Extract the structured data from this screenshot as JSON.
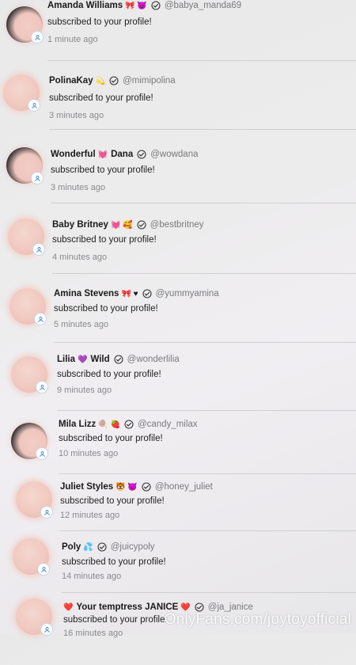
{
  "notifications": [
    {
      "name": "Amanda Williams",
      "emoji": "🎀 😈",
      "handle": "@babya_manda69",
      "message": "subscribed to your profile!",
      "time": "1 minute ago"
    },
    {
      "name": "PolinaKay",
      "emoji": "💫",
      "handle": "@mimipolina",
      "message": "subscribed to your profile!",
      "time": "3 minutes ago"
    },
    {
      "name": "Wonderful",
      "emoji": "💓",
      "name2": "Dana",
      "handle": "@wowdana",
      "message": "subscribed to your profile!",
      "time": "3 minutes ago"
    },
    {
      "name": "Baby Britney",
      "emoji": "💓 🥰",
      "handle": "@bestbritney",
      "message": "subscribed to your profile!",
      "time": "4 minutes ago"
    },
    {
      "name": "Amina Stevens",
      "emoji": "🎀 ♥",
      "handle": "@yummyamina",
      "message": "subscribed to your profile!",
      "time": "5 minutes ago"
    },
    {
      "name": "Lilia",
      "emoji": "💜",
      "name2": "Wild",
      "handle": "@wonderlilia",
      "message": "subscribed to your profile!",
      "time": "9 minutes ago"
    },
    {
      "name": "Mila Lizz",
      "emoji": "🍭 🍓",
      "handle": "@candy_milax",
      "message": "subscribed to your profile!",
      "time": "10 minutes ago"
    },
    {
      "name": "Juliet Styles",
      "emoji": "🐯 😈",
      "handle": "@honey_juliet",
      "message": "subscribed to your profile!",
      "time": "12 minutes ago"
    },
    {
      "name": "Poly",
      "emoji": "💦",
      "handle": "@juicypoly",
      "message": "subscribed to your profile!",
      "time": "14 minutes ago"
    },
    {
      "emoji_pre": "❤️",
      "name": "Your temptress JANICE",
      "emoji": "❤️",
      "handle": "@ja_janice",
      "message": "subscribed to your profile!",
      "time": "16 minutes ago"
    }
  ],
  "watermark": "OnlyFans.com/joytoyofficial"
}
